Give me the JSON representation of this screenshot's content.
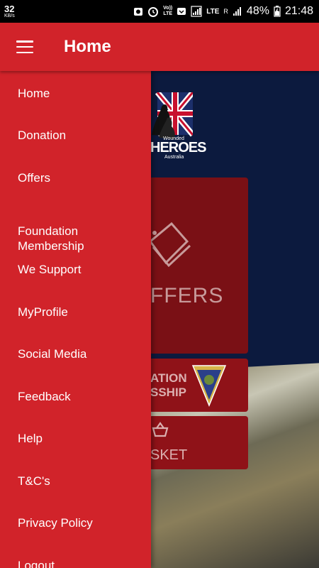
{
  "status_bar": {
    "speed_value": "32",
    "speed_unit": "KB/s",
    "volte": "Vo))",
    "lte_label": "LTE",
    "lte2_label": "LTE",
    "roaming": "R",
    "battery_percent": "48%",
    "time": "21:48"
  },
  "app_bar": {
    "title": "Home",
    "color": "#d1232a"
  },
  "drawer": {
    "items": [
      {
        "label": "Home"
      },
      {
        "label": "Donation"
      },
      {
        "label": "Offers"
      },
      {
        "label": "Foundation\nMembership"
      },
      {
        "label": "We Support"
      },
      {
        "label": "MyProfile"
      },
      {
        "label": "Social Media"
      },
      {
        "label": "Feedback"
      },
      {
        "label": "Help"
      },
      {
        "label": "T&C's"
      },
      {
        "label": "Privacy Policy"
      },
      {
        "label": "Logout"
      }
    ]
  },
  "background": {
    "logo_text_top": "Wounded",
    "logo_text_main": "HEROES",
    "logo_text_bottom": "Australia",
    "offers_label": "FFERS",
    "membership_label_1": "ATION",
    "membership_label_2": "SSHIP",
    "basket_label": "SKET"
  }
}
